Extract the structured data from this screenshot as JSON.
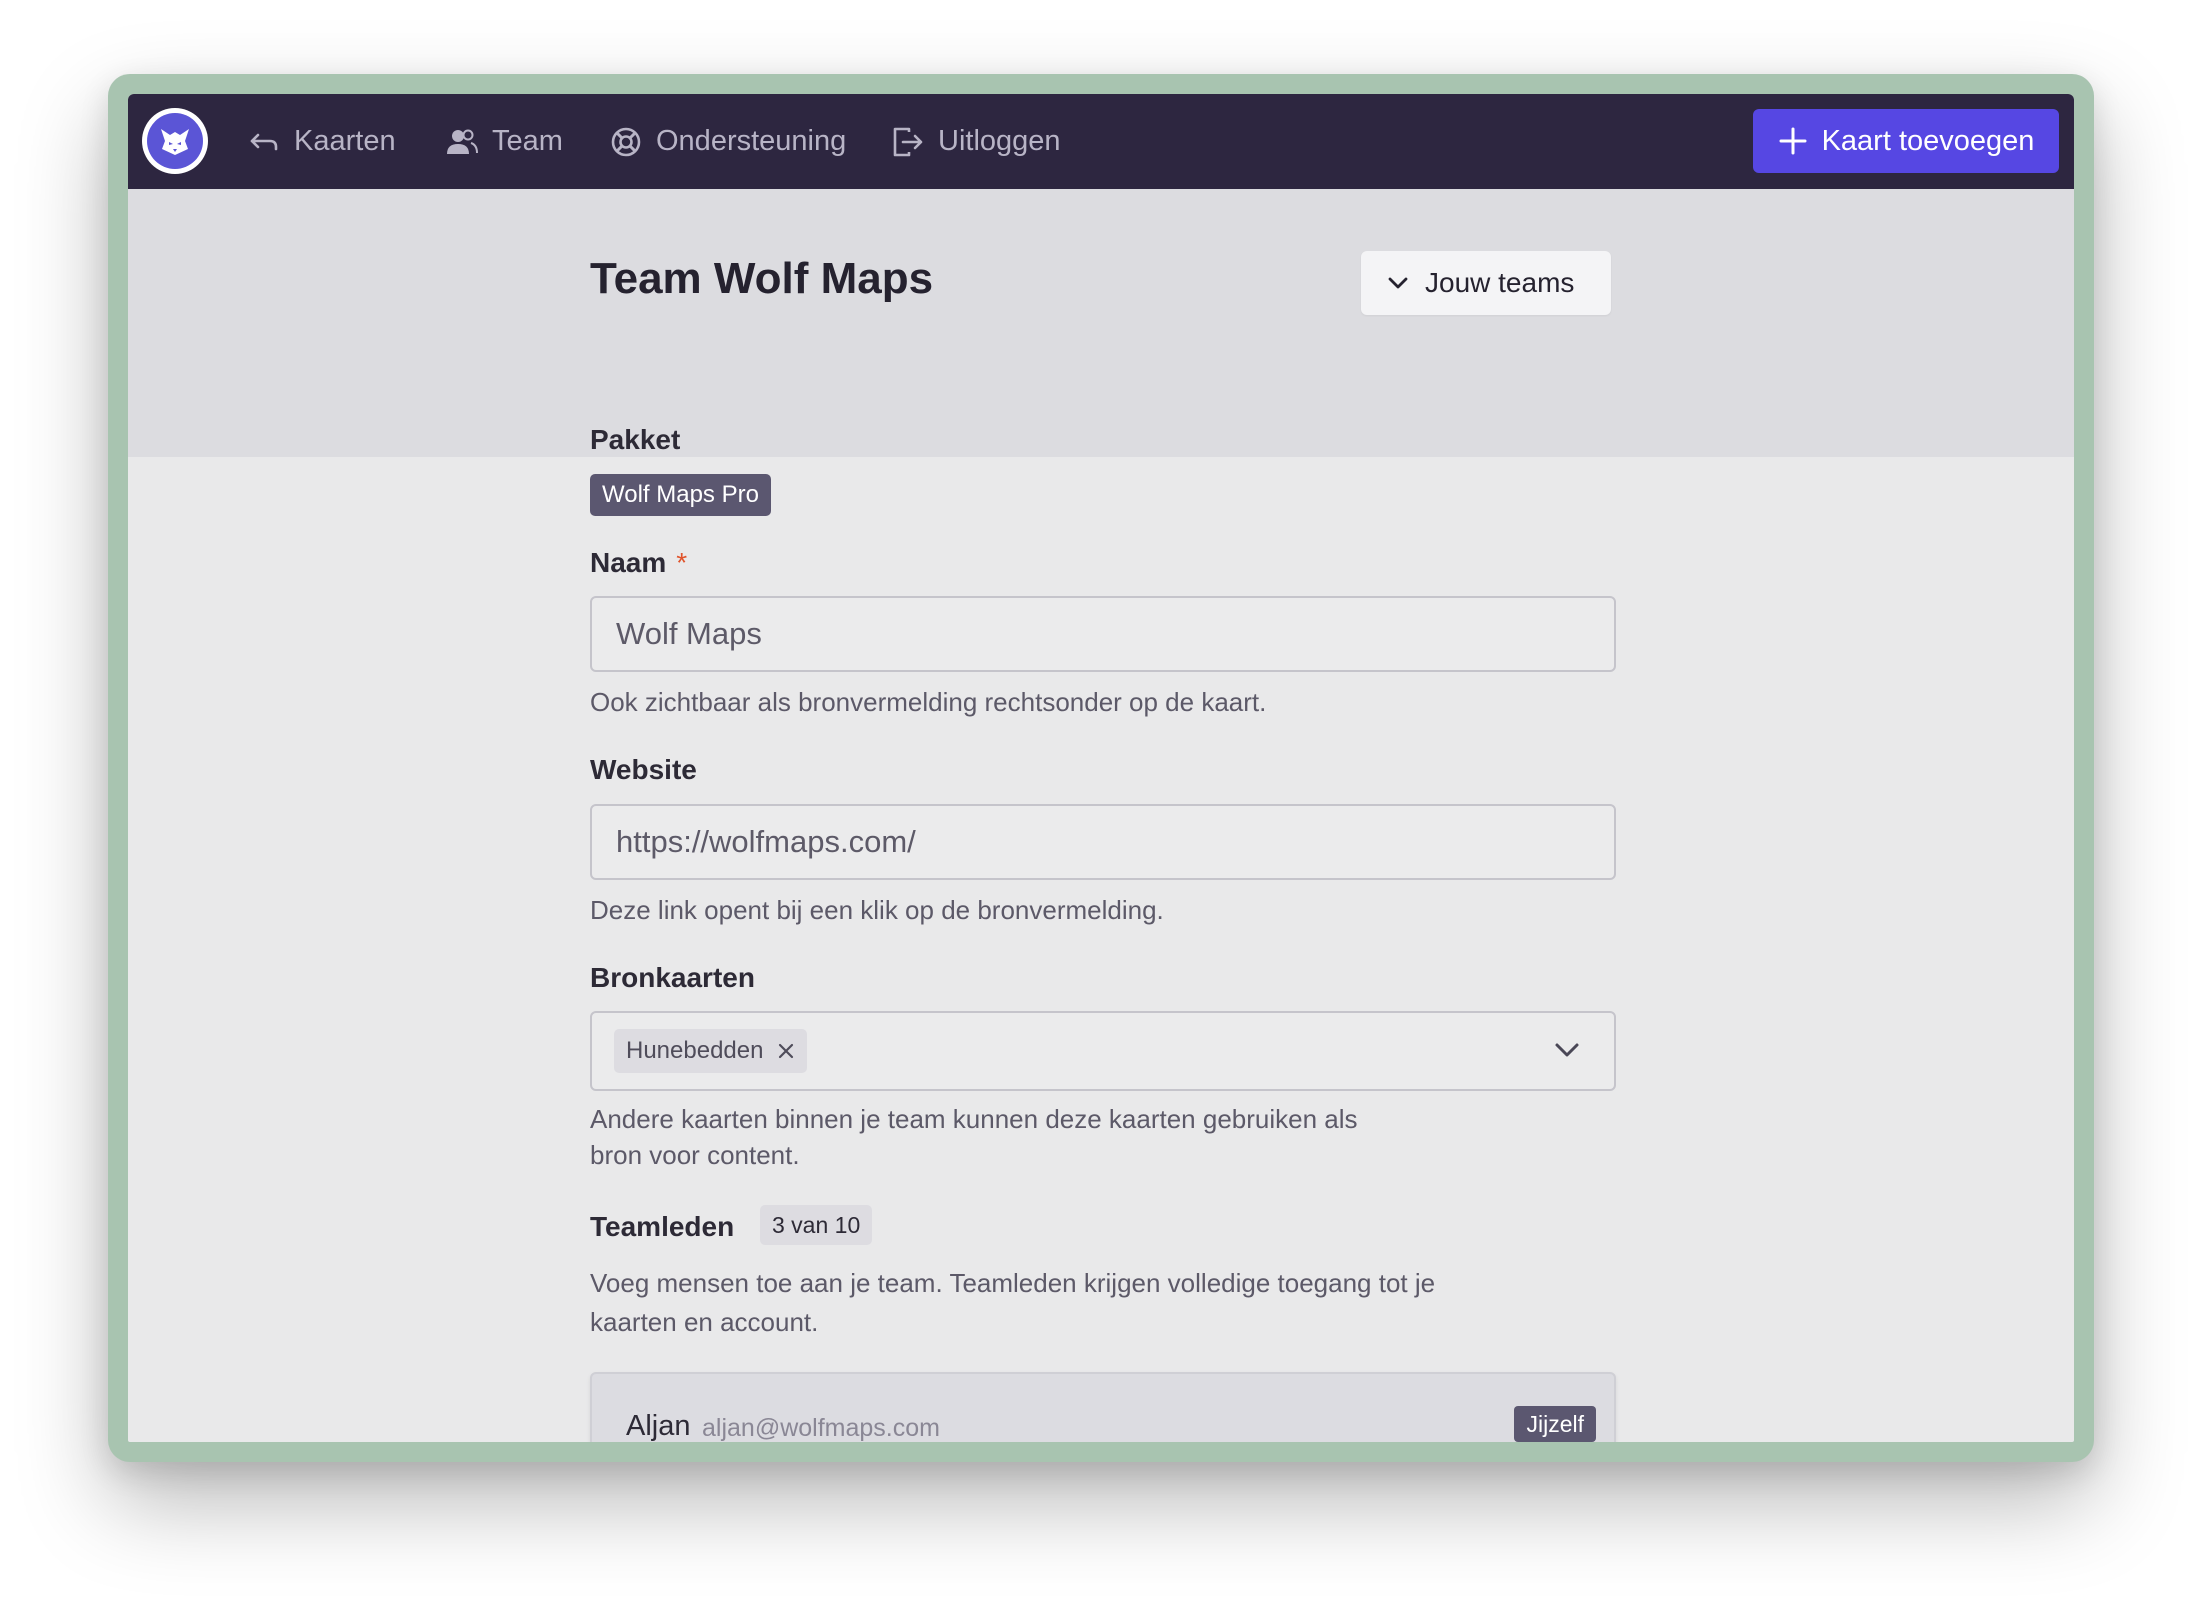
{
  "nav": {
    "maps": "Kaarten",
    "team": "Team",
    "support": "Ondersteuning",
    "logout": "Uitloggen",
    "add_map": "Kaart toevoegen"
  },
  "header": {
    "title": "Team Wolf Maps",
    "teams_button": "Jouw teams"
  },
  "form": {
    "plan": {
      "label": "Pakket",
      "value": "Wolf Maps Pro"
    },
    "name": {
      "label": "Naam",
      "required_mark": "*",
      "value": "Wolf Maps",
      "help": "Ook zichtbaar als bronvermelding rechtsonder op de kaart."
    },
    "website": {
      "label": "Website",
      "value": "https://wolfmaps.com/",
      "help": "Deze link opent bij een klik op de bronvermelding."
    },
    "source_maps": {
      "label": "Bronkaarten",
      "selected": [
        "Hunebedden"
      ],
      "help_line1": "Andere kaarten binnen je team kunnen deze kaarten gebruiken als",
      "help_line2": "bron voor content."
    },
    "members": {
      "label": "Teamleden",
      "count": "3 van 10",
      "help_line1": "Voeg mensen toe aan je team. Teamleden krijgen volledige toegang tot je",
      "help_line2": "kaarten en account.",
      "list": [
        {
          "name": "Aljan",
          "email": "aljan@wolfmaps.com",
          "badge": "Jijzelf"
        }
      ]
    }
  },
  "colors": {
    "navbar": "#2d2640",
    "accent": "#5647e3",
    "badge": "#5b5770",
    "required": "#e0542c",
    "frame": "#a8c4b0"
  }
}
